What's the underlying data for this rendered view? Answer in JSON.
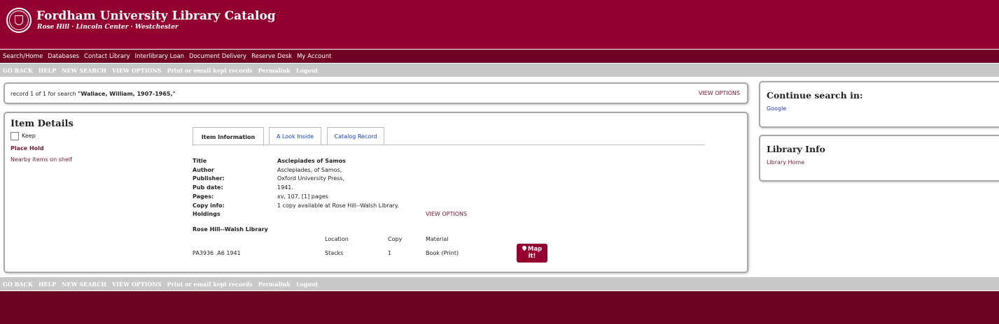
{
  "brand": {
    "title": "Fordham University Library Catalog",
    "subtitle": "Rose Hill · Lincoln Center · Westchester"
  },
  "nav": {
    "items": [
      "Search/Home",
      "Databases",
      "Contact Library",
      "Interlibrary Loan",
      "Document Delivery",
      "Reserve Desk",
      "My Account"
    ]
  },
  "actions": {
    "items": [
      "GO BACK",
      "HELP",
      "NEW SEARCH",
      "VIEW OPTIONS",
      "Print or email kept records",
      "Permalink",
      "Logout"
    ]
  },
  "search_bar": {
    "prefix": "record 1 of 1 for search ",
    "query": "\"Wallace, William, 1907-1965,\"",
    "view_options": "VIEW OPTIONS"
  },
  "item": {
    "heading": "Item Details",
    "keep_label": "Keep",
    "place_hold": "Place Hold",
    "nearby": "Nearby items on shelf",
    "tabs": [
      "Item Information",
      "A Look Inside",
      "Catalog Record"
    ],
    "fields": [
      {
        "label": "Title",
        "value": "Asclepiades of Samos"
      },
      {
        "label": "Author",
        "value": "Asclepiades, of Samos,"
      },
      {
        "label": "Publisher:",
        "value": "Oxford University Press,"
      },
      {
        "label": "Pub date:",
        "value": "1941."
      },
      {
        "label": "Pages:",
        "value": "xv, 107, [1] pages"
      },
      {
        "label": "Copy info:",
        "value": "1 copy available at Rose Hill--Walsh Library."
      },
      {
        "label": "Holdings",
        "value": ""
      }
    ],
    "holdings_view_options": "VIEW OPTIONS",
    "holdings": {
      "library": "Rose Hill--Walsh Library",
      "columns": [
        "Location",
        "Copy",
        "Material"
      ],
      "row": {
        "call_number": "PA3936 .A6 1941",
        "location": "Stacks",
        "copy": "1",
        "material": "Book (Print)"
      },
      "map_button_line1": "Map",
      "map_button_line2": "it!"
    }
  },
  "sidebar": {
    "continue_heading": "Continue search in:",
    "continue_link": "Google",
    "library_heading": "Library Info",
    "library_link": "Library Home"
  },
  "colors": {
    "brand": "#930130",
    "nav": "#6f0225",
    "action_bar": "#c8c8c8",
    "footer": "#6a0421",
    "link": "#1a3fb0",
    "accent_text": "#6b1a2e"
  }
}
